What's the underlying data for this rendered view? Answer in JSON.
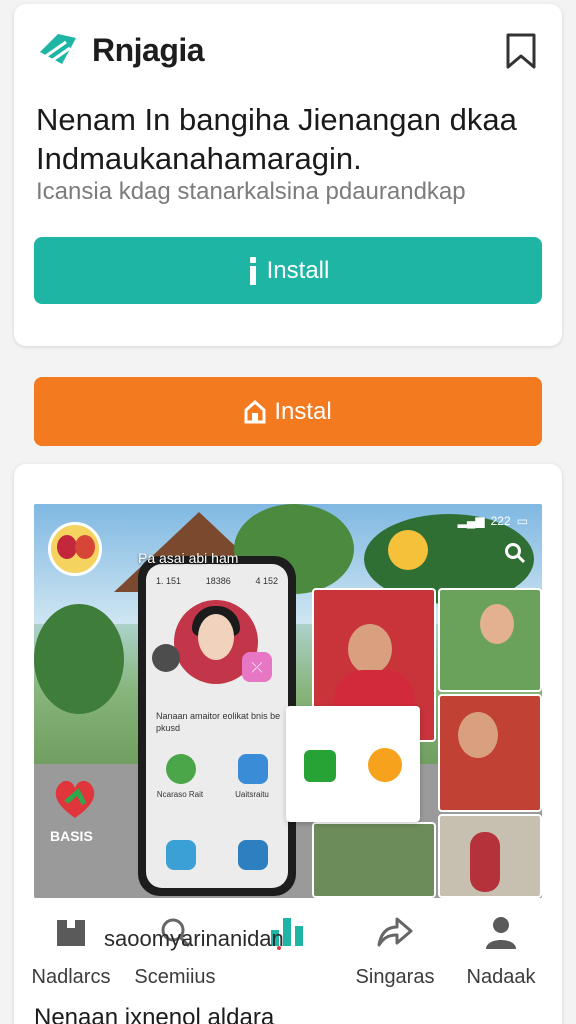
{
  "header": {
    "brand_name": "Rnjagia",
    "headline": "Nenam In bangiha Jienangan dkaa Indmaukanahamaragin.",
    "subline": "Icansia kdag stanarkalsina pdaurandkap"
  },
  "actions": {
    "primary_install_label": "Install",
    "secondary_install_label": "Instal"
  },
  "hero": {
    "status_time": "222",
    "phone_status_left": "1. 151",
    "phone_status_mid": "18386",
    "phone_status_right": "4 152",
    "phone_caption": "Nanaan amaitor eolikat bnis be pkusd",
    "app_label_1": "Ncaraso Rait",
    "app_label_2": "Uaitsraitu",
    "overlay_title": "Pa asai abi ham",
    "brand_mark_label": "BASIS"
  },
  "bottom_nav": {
    "overlay_text": "saoomyarinanidan",
    "items": [
      {
        "label": "Nadlarcs"
      },
      {
        "label": "Scemiius"
      },
      {
        "label": ""
      },
      {
        "label": "Singaras"
      },
      {
        "label": "Nadaak"
      }
    ]
  },
  "footer": {
    "text": "Nenaan ixnenol aldara"
  },
  "colors": {
    "primary": "#1fb5a4",
    "secondary": "#f47a1f",
    "background": "#f3f3f4"
  },
  "icons": [
    "brand-logo-icon",
    "bookmark-icon",
    "info-icon",
    "home-icon",
    "search-icon",
    "share-icon",
    "user-icon",
    "leaderboard-icon"
  ]
}
